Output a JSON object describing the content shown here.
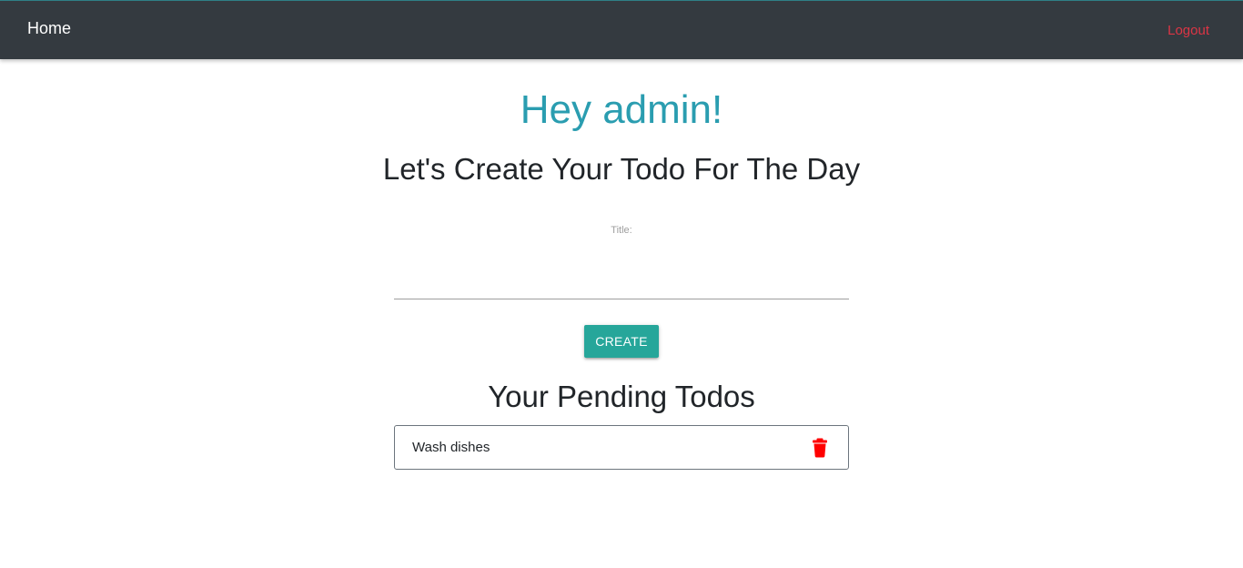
{
  "navbar": {
    "home_label": "Home",
    "logout_label": "Logout"
  },
  "main": {
    "greeting": "Hey admin!",
    "subtitle": "Let's Create Your Todo For The Day",
    "form": {
      "title_label": "Title:",
      "title_value": "",
      "create_button_label": "CREATE"
    },
    "pending": {
      "heading": "Your Pending Todos",
      "todos": [
        {
          "title": "Wash dishes",
          "delete_icon": "trash-icon"
        }
      ]
    }
  },
  "colors": {
    "navbar_bg": "#343a40",
    "logout": "#dc3545",
    "greeting": "#2a9db0",
    "create_button": "#26a69a",
    "trash_icon": "#ff0000"
  }
}
